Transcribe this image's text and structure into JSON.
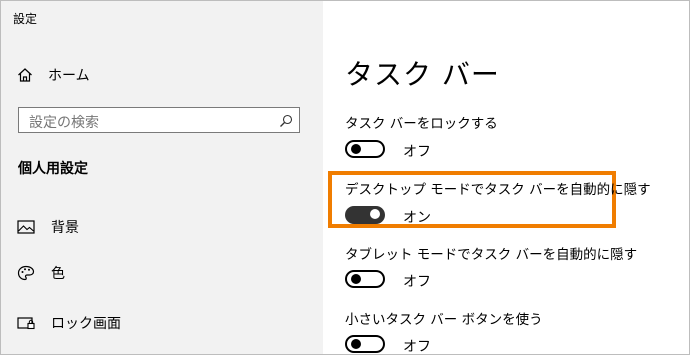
{
  "window": {
    "title": "設定"
  },
  "sidebar": {
    "home_label": "ホーム",
    "search_placeholder": "設定の検索",
    "section_title": "個人用設定",
    "items": [
      {
        "label": "背景",
        "icon": "picture-icon"
      },
      {
        "label": "色",
        "icon": "palette-icon"
      },
      {
        "label": "ロック画面",
        "icon": "lock-screen-icon"
      }
    ]
  },
  "main": {
    "title": "タスク バー",
    "settings": [
      {
        "label": "タスク バーをロックする",
        "state_text": "オフ",
        "on": false
      },
      {
        "label": "デスクトップ モードでタスク バーを自動的に隠す",
        "state_text": "オン",
        "on": true
      },
      {
        "label": "タブレット モードでタスク バーを自動的に隠す",
        "state_text": "オフ",
        "on": false
      },
      {
        "label": "小さいタスク バー ボタンを使う",
        "state_text": "オフ",
        "on": false
      }
    ]
  },
  "colors": {
    "highlight": "#f07d00",
    "sidebar_bg": "#f2f2f2"
  }
}
